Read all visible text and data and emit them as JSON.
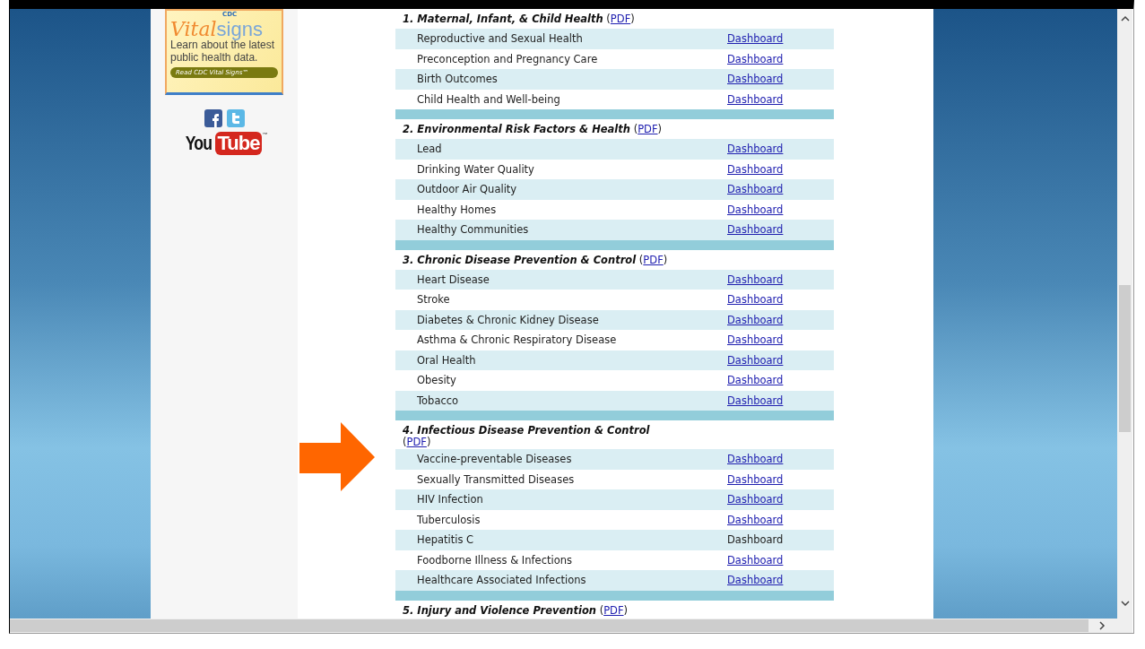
{
  "sidebar": {
    "ad": {
      "brand_small": "CDC",
      "brand_vital": "Vital",
      "brand_signs": "signs",
      "text": "Learn about the latest public health data.",
      "button": "Read CDC Vital Signs™"
    },
    "youtube": {
      "you": "You",
      "tube": "Tube",
      "tm": "™"
    }
  },
  "sections": [
    {
      "title": "1. Maternal, Infant, & Child Health",
      "pdf_before": "(",
      "pdf": "PDF",
      "pdf_after": ")",
      "rows": [
        {
          "topic": "Reproductive and Sexual Health",
          "dashboard": "Dashboard",
          "link": true
        },
        {
          "topic": "Preconception and Pregnancy Care",
          "dashboard": "Dashboard",
          "link": true
        },
        {
          "topic": "Birth Outcomes",
          "dashboard": "Dashboard",
          "link": true
        },
        {
          "topic": "Child Health and Well-being",
          "dashboard": "Dashboard",
          "link": true
        }
      ]
    },
    {
      "title": "2. Environmental Risk Factors & Health",
      "pdf_before": "(",
      "pdf": "PDF",
      "pdf_after": ")",
      "rows": [
        {
          "topic": "Lead",
          "dashboard": "Dashboard",
          "link": true
        },
        {
          "topic": "Drinking Water Quality",
          "dashboard": "Dashboard",
          "link": true
        },
        {
          "topic": "Outdoor Air Quality",
          "dashboard": "Dashboard",
          "link": true
        },
        {
          "topic": "Healthy Homes",
          "dashboard": "Dashboard",
          "link": true
        },
        {
          "topic": "Healthy Communities",
          "dashboard": "Dashboard",
          "link": true
        }
      ]
    },
    {
      "title": "3. Chronic Disease Prevention & Control",
      "pdf_before": "(",
      "pdf": "PDF",
      "pdf_after": ")",
      "rows": [
        {
          "topic": "Heart Disease",
          "dashboard": "Dashboard",
          "link": true
        },
        {
          "topic": "Stroke",
          "dashboard": "Dashboard",
          "link": true
        },
        {
          "topic": "Diabetes & Chronic Kidney Disease",
          "dashboard": "Dashboard",
          "link": true
        },
        {
          "topic": "Asthma & Chronic Respiratory Disease",
          "dashboard": "Dashboard",
          "link": true
        },
        {
          "topic": "Oral Health",
          "dashboard": "Dashboard",
          "link": true
        },
        {
          "topic": "Obesity",
          "dashboard": "Dashboard",
          "link": true
        },
        {
          "topic": "Tobacco",
          "dashboard": "Dashboard",
          "link": true
        }
      ]
    },
    {
      "title": "4. Infectious Disease Prevention & Control",
      "pdf_before": "(",
      "pdf": "PDF",
      "pdf_after": ")",
      "rows": [
        {
          "topic": "Vaccine-preventable Diseases",
          "dashboard": "Dashboard",
          "link": true
        },
        {
          "topic": "Sexually Transmitted Diseases",
          "dashboard": "Dashboard",
          "link": true
        },
        {
          "topic": "HIV Infection",
          "dashboard": "Dashboard",
          "link": true
        },
        {
          "topic": "Tuberculosis",
          "dashboard": "Dashboard",
          "link": true
        },
        {
          "topic": "Hepatitis C",
          "dashboard": "Dashboard",
          "link": false
        },
        {
          "topic": "Foodborne Illness & Infections",
          "dashboard": "Dashboard",
          "link": true
        },
        {
          "topic": "Healthcare Associated Infections",
          "dashboard": "Dashboard",
          "link": true
        }
      ]
    },
    {
      "title": "5. Injury and Violence Prevention",
      "pdf_before": "(",
      "pdf": "PDF",
      "pdf_after": ")"
    }
  ]
}
